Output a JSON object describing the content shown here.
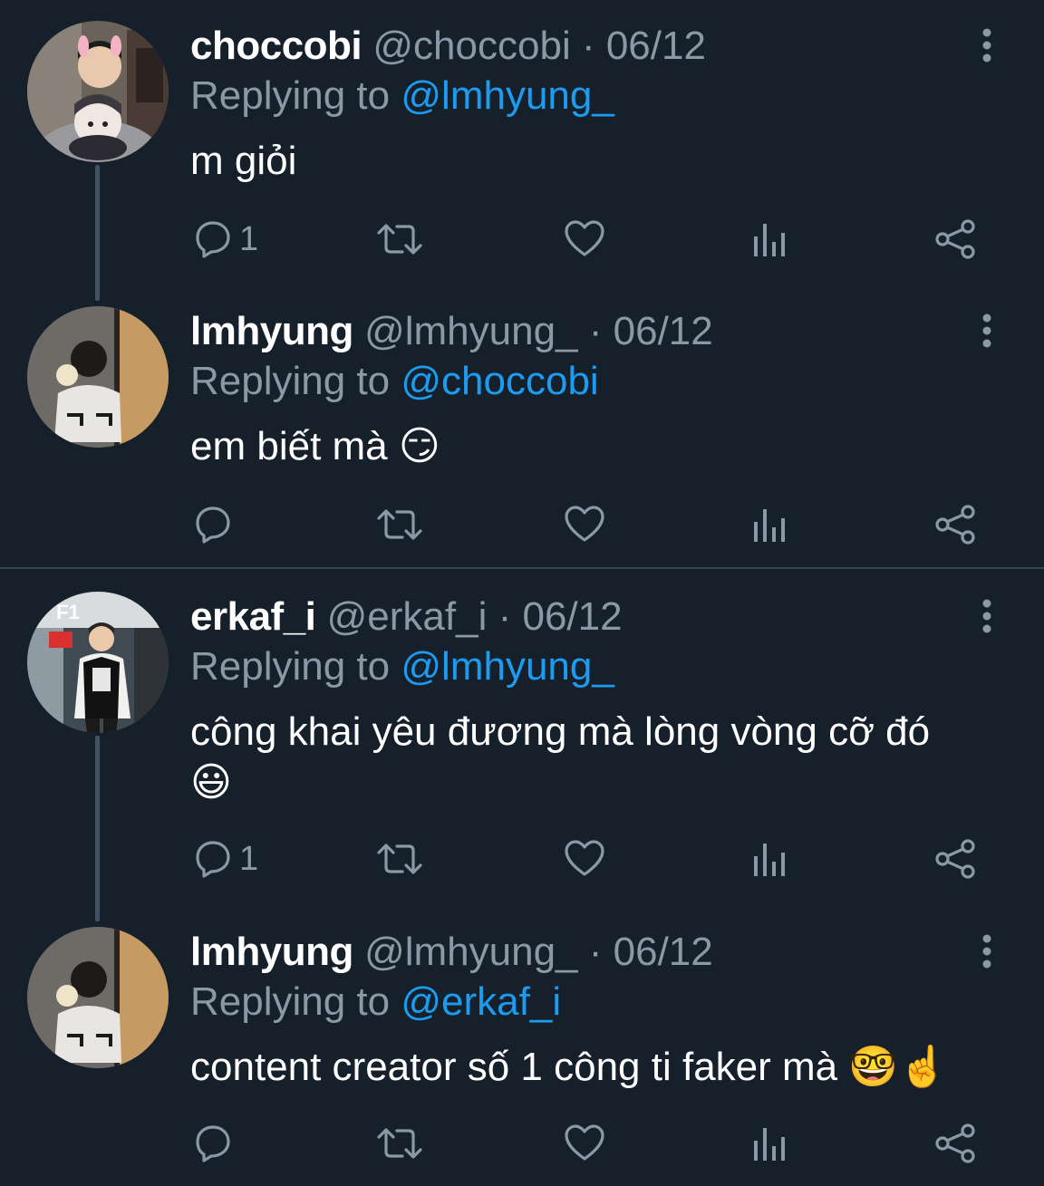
{
  "tweets": [
    {
      "name": "choccobi",
      "handle": "@choccobi",
      "date": "· 06/12",
      "replying_prefix": "Replying to",
      "replying_to": "@lmhyung_",
      "text": "m giỏi",
      "emoji": "",
      "reply_count": "1"
    },
    {
      "name": "lmhyung",
      "handle": "@lmhyung_",
      "date": "· 06/12",
      "replying_prefix": "Replying to",
      "replying_to": "@choccobi",
      "text": "em biết mà",
      "emoji": "😏",
      "reply_count": ""
    },
    {
      "name": "erkaf_i",
      "handle": "@erkaf_i",
      "date": "· 06/12",
      "replying_prefix": "Replying to",
      "replying_to": "@lmhyung_",
      "text": "công khai yêu đương mà lòng vòng cỡ đó",
      "emoji": "😃",
      "reply_count": "1"
    },
    {
      "name": "lmhyung",
      "handle": "@lmhyung_",
      "date": "· 06/12",
      "replying_prefix": "Replying to",
      "replying_to": "@erkaf_i",
      "text": "content creator số 1 công ti faker mà",
      "emoji": "🤓☝️",
      "reply_count": ""
    }
  ],
  "icons": {
    "reply": "reply-icon",
    "retweet": "retweet-icon",
    "like": "like-icon",
    "views": "views-icon",
    "share": "share-icon",
    "more": "more-vertical-icon"
  },
  "colors": {
    "background": "#15202b",
    "mention": "#1d9bf0",
    "muted": "#8b98a5",
    "thread_line": "#3d5466",
    "divider": "#38444d"
  }
}
